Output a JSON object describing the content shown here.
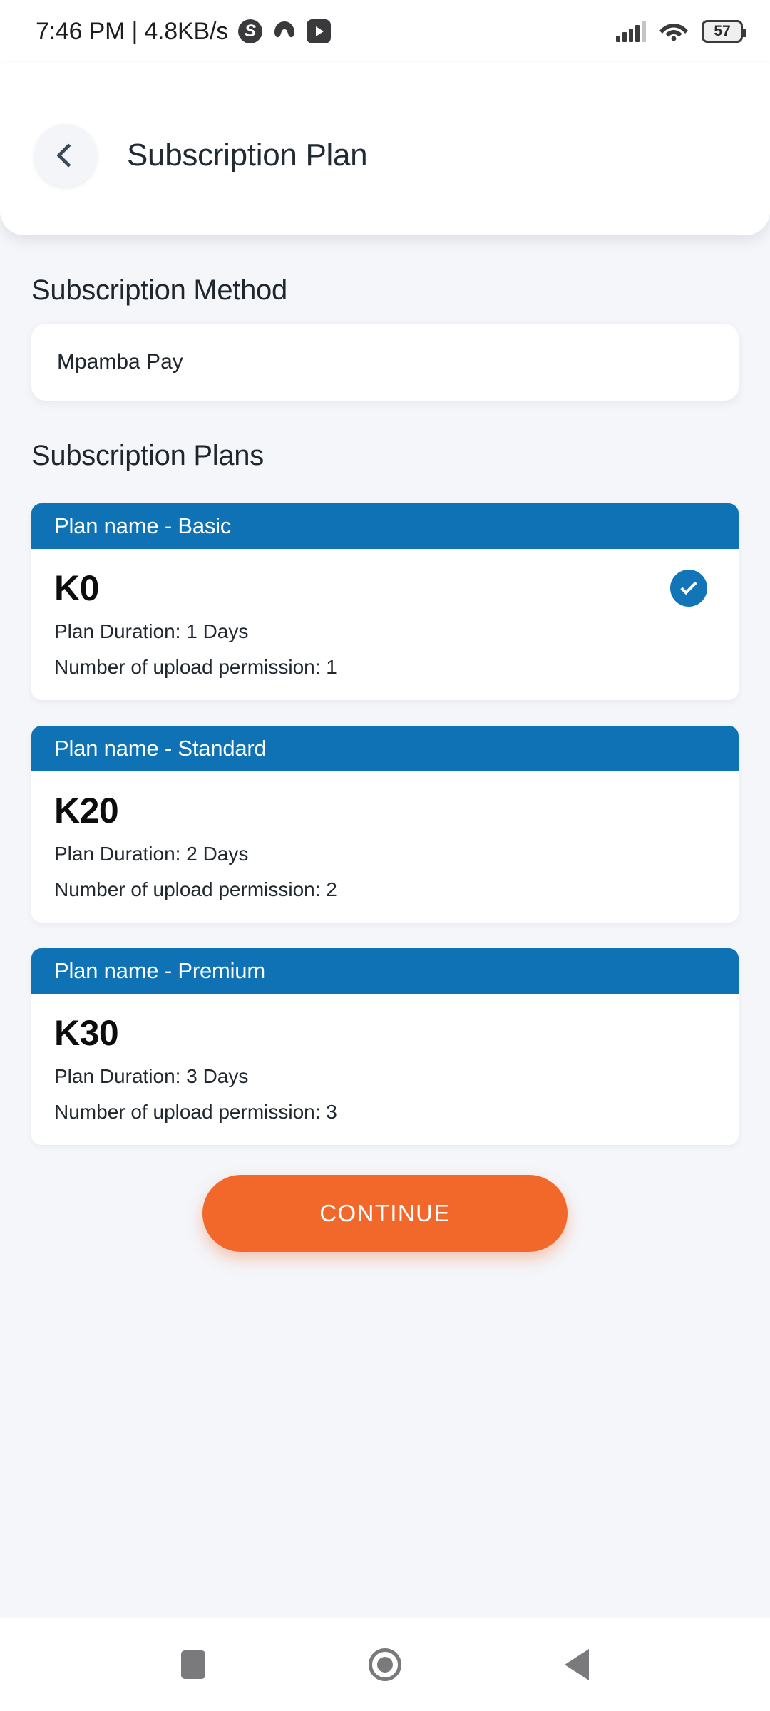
{
  "status_bar": {
    "time_and_speed": "7:46 PM | 4.8KB/s",
    "app_icons": [
      "skype-icon",
      "blob-app-icon",
      "youtube-icon"
    ],
    "skype_glyph": "S",
    "signal_icon": "signal-bars-icon",
    "wifi_icon": "wifi-icon",
    "battery_level": "57"
  },
  "header": {
    "back_icon": "chevron-left-icon",
    "title": "Subscription Plan"
  },
  "method_section": {
    "heading": "Subscription Method",
    "selected_method": "Mpamba Pay"
  },
  "plans_section": {
    "heading": "Subscription Plans",
    "plans": [
      {
        "header": "Plan name - Basic",
        "price": "K0",
        "duration": "Plan Duration: 1 Days",
        "uploads": "Number of upload permission: 1",
        "selected": true
      },
      {
        "header": "Plan name - Standard",
        "price": "K20",
        "duration": "Plan Duration: 2 Days",
        "uploads": "Number of upload permission: 2",
        "selected": false
      },
      {
        "header": "Plan name - Premium",
        "price": "K30",
        "duration": "Plan Duration: 3 Days",
        "uploads": "Number of upload permission: 3",
        "selected": false
      }
    ]
  },
  "actions": {
    "continue_label": "CONTINUE"
  },
  "nav_bar": {
    "recents_icon": "square-recents-icon",
    "home_icon": "circle-home-icon",
    "back_icon": "triangle-back-icon"
  },
  "colors": {
    "plan_header_blue": "#0f72b5",
    "check_blue": "#1275b8",
    "continue_orange": "#f2682a",
    "page_background": "#f4f6fa"
  }
}
